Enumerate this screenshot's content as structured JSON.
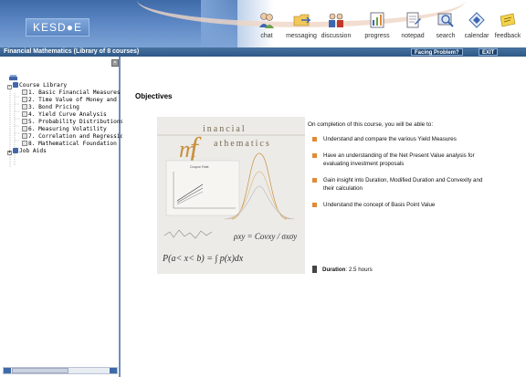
{
  "header": {
    "logo_text": "KESD●E",
    "toolbar": [
      {
        "label": "chat",
        "icon": "chat-icon"
      },
      {
        "label": "messaging",
        "icon": "messaging-icon"
      },
      {
        "label": "discussion",
        "icon": "discussion-icon"
      },
      {
        "label": "progress",
        "icon": "progress-icon"
      },
      {
        "label": "notepad",
        "icon": "notepad-icon"
      },
      {
        "label": "search",
        "icon": "search-icon"
      },
      {
        "label": "calendar",
        "icon": "calendar-icon"
      },
      {
        "label": "feedback",
        "icon": "feedback-icon"
      }
    ]
  },
  "titlebar": {
    "course_title": "Financial Mathematics (Library of 8 courses)",
    "facing_problem": "Facing Problem?",
    "exit": "EXIT"
  },
  "sidebar": {
    "root_label": "Course Library",
    "courses": [
      "1. Basic Financial Measures",
      "2. Time Value of Money and",
      "3. Bond Pricing",
      "4. Yield Curve Analysis",
      "5. Probability Distributions ar",
      "6. Measuring Volatility",
      "7. Correlation and Regressio",
      "8. Mathematical Foundation"
    ],
    "job_aids": "Job Aids"
  },
  "main": {
    "heading": "Objectives",
    "intro": "On completion of this course, you will be able to:",
    "objectives": [
      "Understand and compare the various Yield Measures",
      "Have an understanding of the Net Present Value analysis for evaluating investment proposals",
      "Gain insight into Duration, Modified Duration and Convexity and their calculation",
      "Understand the concept of Basis Point Value"
    ],
    "duration_label": "Duration",
    "duration_value": ": 2.5 hours"
  },
  "image": {
    "title_line1": "inancial",
    "title_line2": "athematics",
    "big_f": "f",
    "big_m": "m",
    "chart_caption": "Coupon Rate",
    "formula1": "ρxy = Covxy / σxσy",
    "formula2": "P(a< x< b) = ∫ p(x)dx"
  },
  "colors": {
    "header_blue": "#4a77b4",
    "titlebar": "#2e5887",
    "bullet": "#e28a33",
    "accent_f": "#c9903f"
  }
}
